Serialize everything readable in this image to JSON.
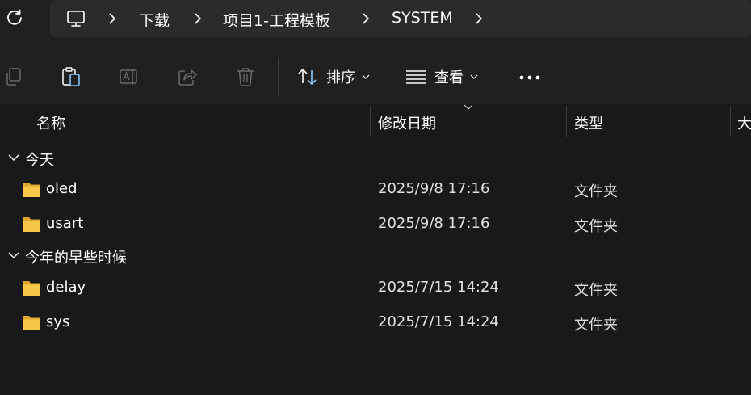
{
  "breadcrumb": {
    "items": [
      "下载",
      "项目1-工程模板",
      "SYSTEM"
    ]
  },
  "toolbar": {
    "sort_label": "排序",
    "view_label": "查看"
  },
  "columns": {
    "name": "名称",
    "modified": "修改日期",
    "type": "类型",
    "size": "大"
  },
  "groups": [
    {
      "label": "今天",
      "rows": [
        {
          "name": "oled",
          "modified": "2025/9/8 17:16",
          "type": "文件夹"
        },
        {
          "name": "usart",
          "modified": "2025/9/8 17:16",
          "type": "文件夹"
        }
      ]
    },
    {
      "label": "今年的早些时候",
      "rows": [
        {
          "name": "delay",
          "modified": "2025/7/15 14:24",
          "type": "文件夹"
        },
        {
          "name": "sys",
          "modified": "2025/7/15 14:24",
          "type": "文件夹"
        }
      ]
    }
  ],
  "colors": {
    "background": "#191919",
    "chrome": "#202020",
    "address_bar": "#2b2b2b",
    "folder_yellow": "#f7c847",
    "accent": "#8fc8f5"
  }
}
